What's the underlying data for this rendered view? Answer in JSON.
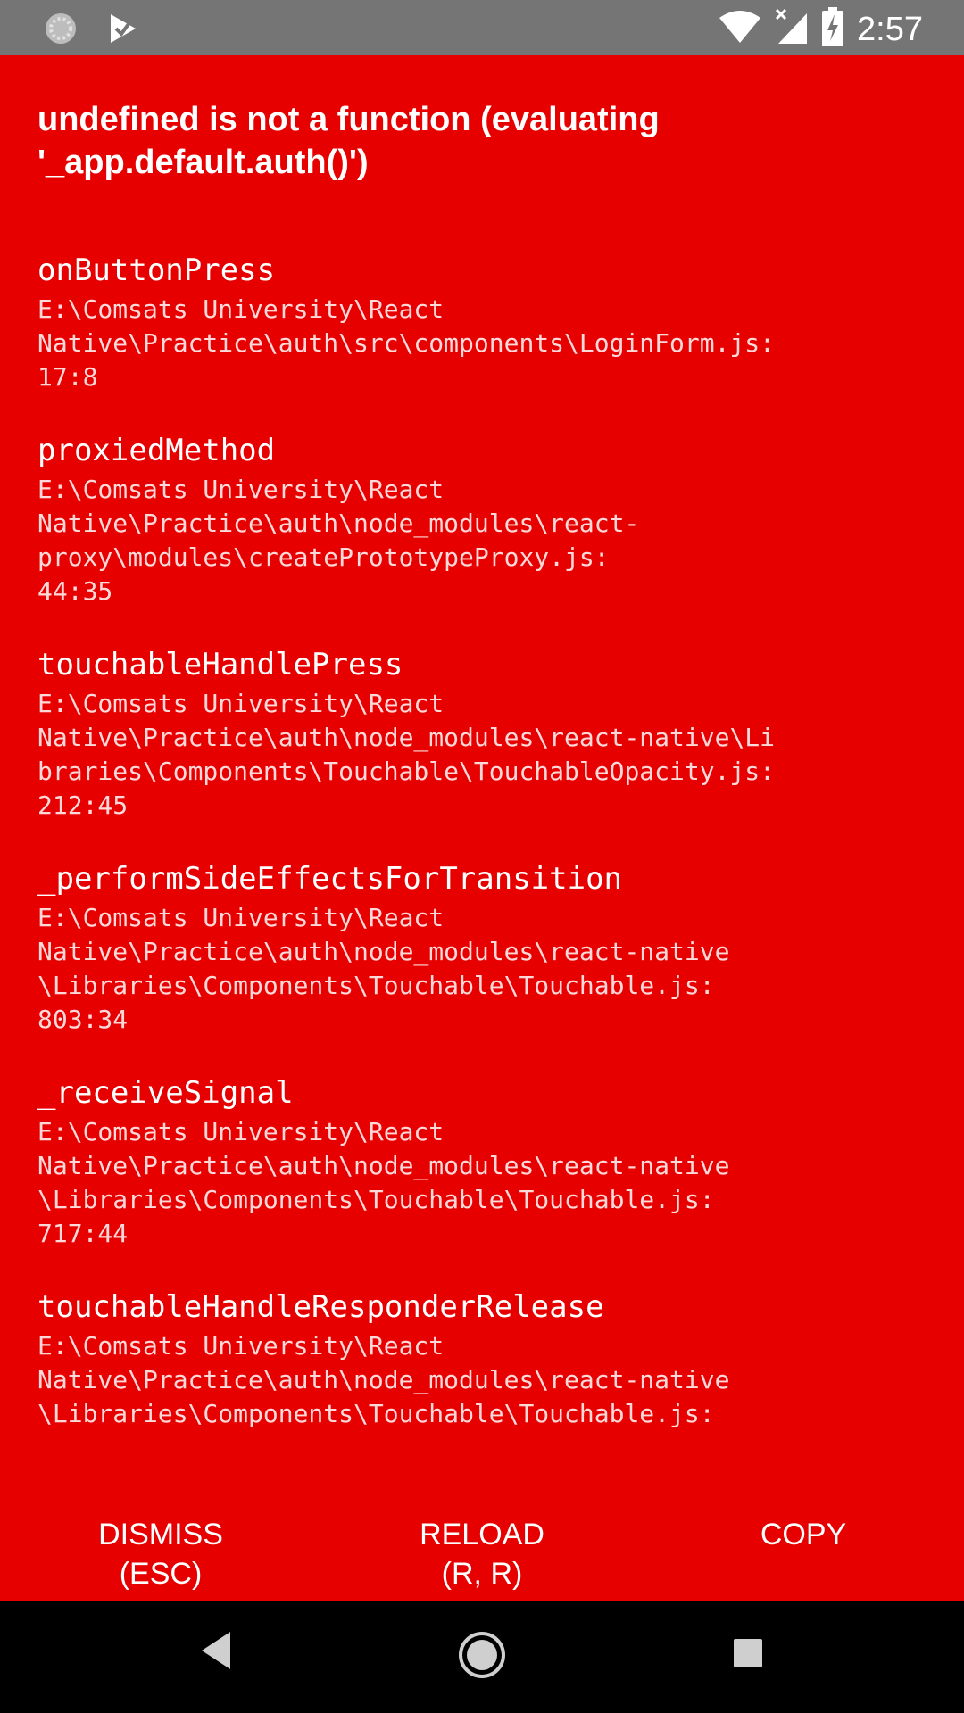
{
  "status_bar": {
    "time": "2:57",
    "icons": [
      "loading-spinner-icon",
      "check-flag-icon",
      "wifi-icon",
      "cellular-no-data-icon",
      "battery-charging-icon"
    ]
  },
  "error": {
    "title": "undefined is not a function (evaluating\n'_app.default.auth()')",
    "stack": [
      {
        "method": "onButtonPress",
        "location": "E:\\Comsats University\\React\nNative\\Practice\\auth\\src\\components\\LoginForm.js:\n17:8"
      },
      {
        "method": "proxiedMethod",
        "location": "E:\\Comsats University\\React\nNative\\Practice\\auth\\node_modules\\react-\nproxy\\modules\\createPrototypeProxy.js:\n44:35"
      },
      {
        "method": "touchableHandlePress",
        "location": "E:\\Comsats University\\React\nNative\\Practice\\auth\\node_modules\\react-native\\Li\nbraries\\Components\\Touchable\\TouchableOpacity.js:\n212:45"
      },
      {
        "method": "_performSideEffectsForTransition",
        "location": "E:\\Comsats University\\React\nNative\\Practice\\auth\\node_modules\\react-native\n\\Libraries\\Components\\Touchable\\Touchable.js:\n803:34"
      },
      {
        "method": "_receiveSignal",
        "location": "E:\\Comsats University\\React\nNative\\Practice\\auth\\node_modules\\react-native\n\\Libraries\\Components\\Touchable\\Touchable.js:\n717:44"
      },
      {
        "method": "touchableHandleResponderRelease",
        "location": "E:\\Comsats University\\React\nNative\\Practice\\auth\\node_modules\\react-native\n\\Libraries\\Components\\Touchable\\Touchable.js:"
      }
    ]
  },
  "actions": {
    "dismiss": "DISMISS\n(ESC)",
    "reload": "RELOAD\n(R, R)",
    "copy": "COPY"
  },
  "colors": {
    "error_red": "#e60000",
    "status_bar_gray": "#757575",
    "nav_bar_black": "#000000"
  }
}
